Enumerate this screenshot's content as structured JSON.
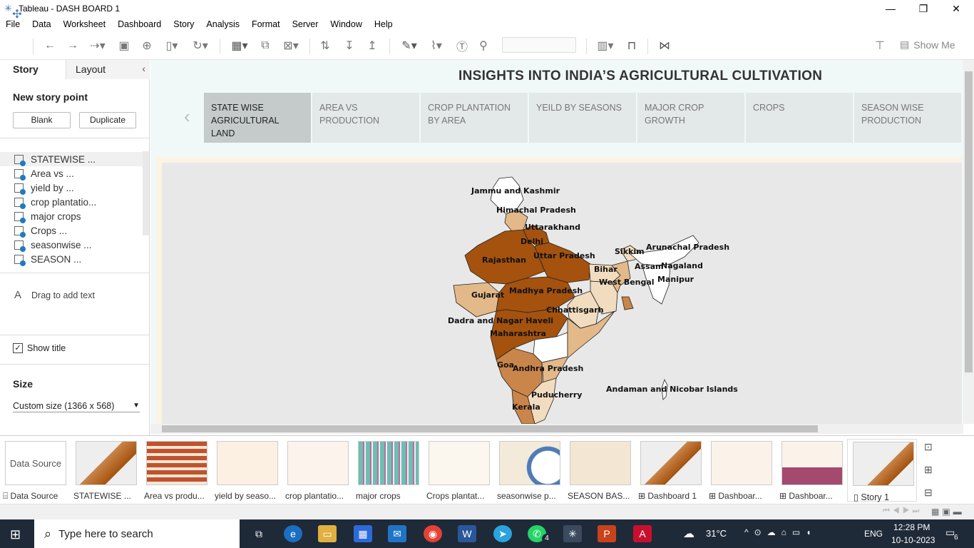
{
  "window": {
    "title": "Tableau - DASH BOARD 1"
  },
  "menu": [
    "File",
    "Data",
    "Worksheet",
    "Dashboard",
    "Story",
    "Analysis",
    "Format",
    "Server",
    "Window",
    "Help"
  ],
  "toolbar": {
    "show_me": "Show Me"
  },
  "left": {
    "tab_story": "Story",
    "tab_layout": "Layout",
    "new_story_point": "New story point",
    "blank": "Blank",
    "duplicate": "Duplicate",
    "sheets": [
      "STATEWISE ...",
      "Area vs ...",
      "yield by ...",
      "crop plantatio...",
      "major crops",
      "Crops ...",
      "seasonwise ...",
      "SEASON ..."
    ],
    "drag_text": "Drag to add text",
    "drag_glyph": "A",
    "show_title": "Show title",
    "size_label": "Size",
    "size_value": "Custom size (1366 x 568)"
  },
  "story": {
    "title": "INSIGHTS INTO INDIA’S AGRICULTURAL CULTIVATION",
    "points": [
      "STATE WISE AGRICULTURAL LAND",
      "AREA VS PRODUCTION",
      "CROP PLANTATION BY AREA",
      "YEILD BY SEASONS",
      "MAJOR CROP GROWTH",
      "CROPS",
      "SEASON WISE PRODUCTION"
    ]
  },
  "map_labels": [
    "Jammu and Kashmir",
    "Himachal Pradesh",
    "Uttarakhand",
    "Delhi",
    "Rajasthan",
    "Uttar Pradesh",
    "Sikkim",
    "Arunachal Pradesh",
    "Assam",
    "Nagaland",
    "Bihar",
    "West Bengal",
    "Manipur",
    "Gujarat",
    "Madhya Pradesh",
    "Chhattisgarh",
    "Dadra and Nagar Haveli",
    "Maharashtra",
    "Goa",
    "Andhra Pradesh",
    "Puducherry",
    "Kerala",
    "Andaman and Nicobar Islands"
  ],
  "filmstrip": [
    "Data Source",
    "STATEWISE ...",
    "Area vs produ...",
    "yield by seaso...",
    "crop plantatio...",
    "major crops",
    "Crops plantat...",
    "seasonwise p...",
    "SEASON BAS...",
    "Dashboard 1",
    "Dashboar...",
    "Dashboar...",
    "Story 1"
  ],
  "taskbar": {
    "search": "Type here to search",
    "weather": "31°C",
    "lang": "ENG",
    "time": "12:28 PM",
    "date": "10-10-2023",
    "notifications": "6",
    "whatsapp_badge": "4"
  },
  "colors": {
    "dark": "#a4520e",
    "mid": "#c9854a",
    "light": "#e3b98a",
    "pale": "#f2dcc0"
  }
}
